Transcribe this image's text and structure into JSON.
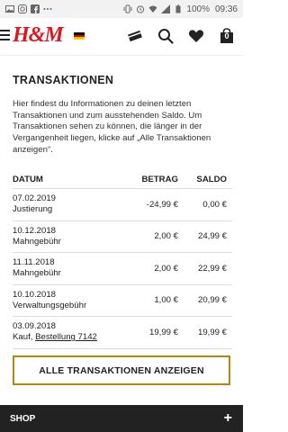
{
  "status_bar": {
    "battery_percent": "100%",
    "time": "09:36",
    "left_icons": [
      "image-icon",
      "instagram-icon",
      "facebook-icon",
      "more-dots-icon"
    ],
    "right_icons": [
      "vibrate-icon",
      "alarm-icon",
      "wifi-icon",
      "signal-icon",
      "battery-icon"
    ]
  },
  "header": {
    "logo": "H&M",
    "flag_colors": [
      "#000000",
      "#dd0000",
      "#ffce00"
    ],
    "icons": [
      "card-icon",
      "search-icon",
      "heart-icon",
      "bag-icon"
    ],
    "bag_count": "0"
  },
  "page": {
    "title": "TRANSAKTIONEN",
    "intro": "Hier findest du Informationen zu deinen letzten Transaktionen und zum ausstehenden Saldo. Um Transaktionen sehen zu können, die länger in der Vergangenheit liegen, klicke auf „Alle Transaktionen anzeigen“."
  },
  "table": {
    "headers": [
      "DATUM",
      "BETRAG",
      "SALDO"
    ],
    "rows": [
      {
        "date": "07.02.2019",
        "desc": "Justierung",
        "amount": "-24,99 €",
        "balance": "0,00 €"
      },
      {
        "date": "10.12.2018",
        "desc": "Mahngebühr",
        "amount": "2,00 €",
        "balance": "24,99 €"
      },
      {
        "date": "11.11.2018",
        "desc": "Mahngebühr",
        "amount": "2,00 €",
        "balance": "22,99 €"
      },
      {
        "date": "10.10.2018",
        "desc": "Verwaltungsgebühr",
        "amount": "1,00 €",
        "balance": "20,99 €"
      },
      {
        "date": "03.09.2018",
        "desc_prefix": "Kauf,",
        "desc_link": "Bestellung 7142",
        "amount": "19,99 €",
        "balance": "19,99 €"
      }
    ]
  },
  "cta_label": "ALLE TRANSAKTIONEN ANZEIGEN",
  "footer": {
    "label": "SHOP",
    "toggle": "+"
  },
  "colors": {
    "brand_red": "#e1131b",
    "cta_border": "#b8860b",
    "footer_bg": "#222222"
  }
}
